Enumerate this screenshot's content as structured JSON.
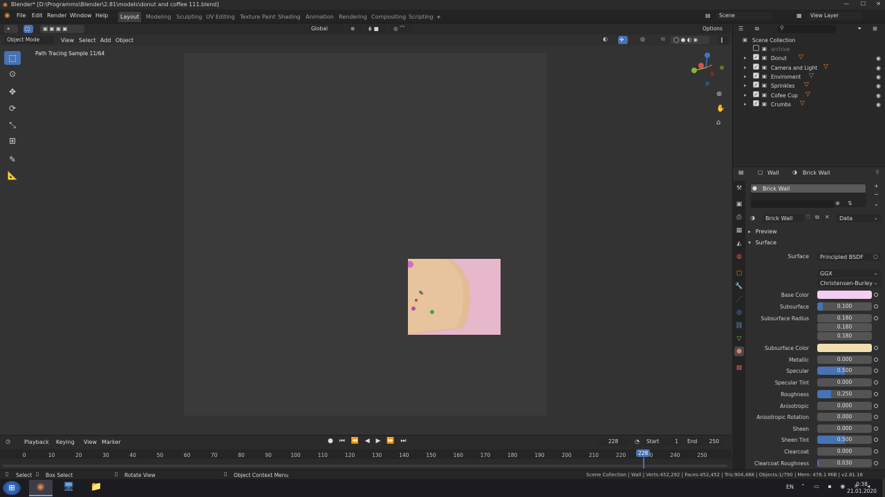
{
  "window": {
    "title": "Blender* [D:\\Programms\\Blender\\2.81\\models\\donut and coffee 111.blend]"
  },
  "menu": {
    "items": [
      "File",
      "Edit",
      "Render",
      "Window",
      "Help"
    ]
  },
  "workspaces": [
    "Layout",
    "Modeling",
    "Sculpting",
    "UV Editing",
    "Texture Paint",
    "Shading",
    "Animation",
    "Rendering",
    "Compositing",
    "Scripting"
  ],
  "workspace_add": "+",
  "scene": {
    "label": "Scene",
    "view_layer": "View Layer"
  },
  "toolbar": {
    "orientation": "Global",
    "options": "Options"
  },
  "viewport": {
    "mode": "Object Mode",
    "menus": [
      "View",
      "Select",
      "Add",
      "Object"
    ],
    "render_status": "Path Tracing Sample 11/64"
  },
  "outliner": {
    "root": "Scene Collection",
    "items": [
      {
        "name": "archive",
        "dim": true
      },
      {
        "name": "Donut"
      },
      {
        "name": "Camera and Light"
      },
      {
        "name": "Enviroment"
      },
      {
        "name": "Sprinkles"
      },
      {
        "name": "Cofee Cup"
      },
      {
        "name": "Crumbs"
      }
    ]
  },
  "properties": {
    "breadcrumb_object": "Wall",
    "breadcrumb_material": "Brick Wall",
    "slot_name": "Brick Wall",
    "material_name": "Brick Wall",
    "link": "Data",
    "panels": {
      "preview": "Preview",
      "surface": "Surface"
    },
    "surface_label": "Surface",
    "surface_shader": "Principled BSDF",
    "distribution": "GGX",
    "subsurface_method": "Christensen-Burley",
    "fields": [
      {
        "label": "Base Color",
        "type": "color",
        "color": "#f4cdf2"
      },
      {
        "label": "Subsurface",
        "value": "0.100",
        "fill": 0.1
      },
      {
        "label": "Subsurface Radius",
        "value": "0.180",
        "fill": 0
      },
      {
        "label": "",
        "value": "0.180",
        "fill": 0
      },
      {
        "label": "",
        "value": "0.180",
        "fill": 0
      },
      {
        "label": "Subsurface Color",
        "type": "color",
        "color": "#f0deb0"
      },
      {
        "label": "Metallic",
        "value": "0.000",
        "fill": 0
      },
      {
        "label": "Specular",
        "value": "0.500",
        "fill": 0.5
      },
      {
        "label": "Specular Tint",
        "value": "0.000",
        "fill": 0
      },
      {
        "label": "Roughness",
        "value": "0.250",
        "fill": 0.25
      },
      {
        "label": "Anisotropic",
        "value": "0.000",
        "fill": 0
      },
      {
        "label": "Anisotropic Rotation",
        "value": "0.000",
        "fill": 0
      },
      {
        "label": "Sheen",
        "value": "0.000",
        "fill": 0
      },
      {
        "label": "Sheen Tint",
        "value": "0.500",
        "fill": 0.5
      },
      {
        "label": "Clearcoat",
        "value": "0.000",
        "fill": 0
      },
      {
        "label": "Clearcoat Roughness",
        "value": "0.030",
        "fill": 0.03
      }
    ]
  },
  "timeline": {
    "menus": [
      "Playback",
      "Keying",
      "View",
      "Marker"
    ],
    "current_frame": "228",
    "start_label": "Start",
    "start": "1",
    "end_label": "End",
    "end": "250",
    "ticks": [
      "0",
      "10",
      "20",
      "30",
      "40",
      "50",
      "60",
      "70",
      "80",
      "90",
      "100",
      "110",
      "120",
      "130",
      "140",
      "150",
      "160",
      "170",
      "180",
      "190",
      "200",
      "210",
      "220",
      "230",
      "240",
      "250"
    ],
    "playhead_label": "228"
  },
  "statusbar": {
    "select": "Select",
    "box_select": "Box Select",
    "rotate": "Rotate View",
    "context": "Object Context Menu",
    "stats": "Scene Collection | Wall | Verts:452,292 | Faces:452,452 | Tris:904,488 | Objects:1/790 | Mem: 478.1 MiB | v2.81.16"
  },
  "taskbar": {
    "lang": "EN",
    "time": "0:38",
    "date": "21.01.2020"
  },
  "colors": {
    "accent": "#4772b3",
    "orange": "#e0873a"
  }
}
